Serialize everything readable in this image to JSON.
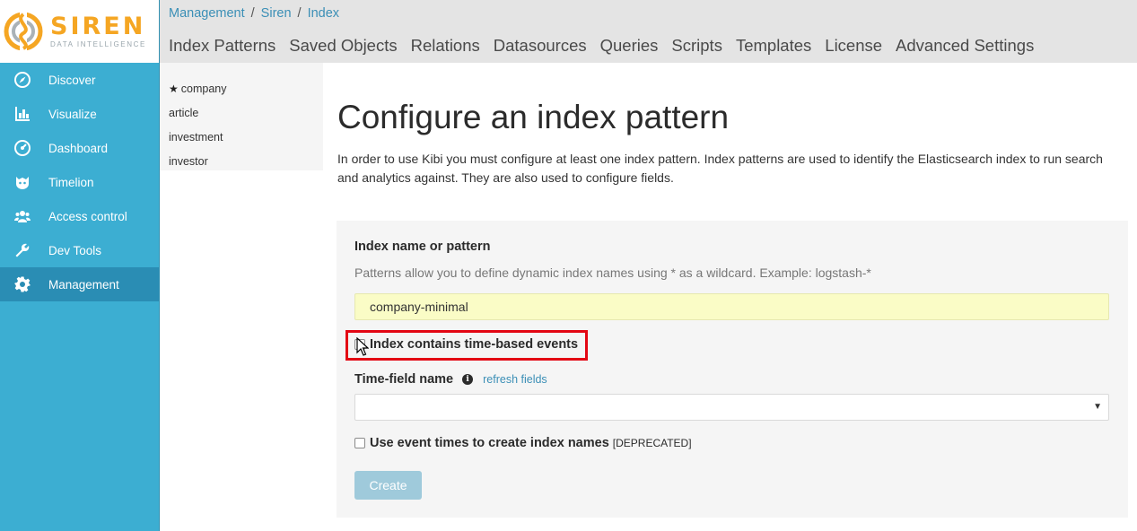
{
  "logo": {
    "word": "SIREN",
    "sub": "DATA INTELLIGENCE"
  },
  "sidebar": {
    "items": [
      {
        "label": "Discover",
        "icon": "compass-icon"
      },
      {
        "label": "Visualize",
        "icon": "bar-chart-icon"
      },
      {
        "label": "Dashboard",
        "icon": "dashboard-icon"
      },
      {
        "label": "Timelion",
        "icon": "timelion-icon"
      },
      {
        "label": "Access control",
        "icon": "users-icon"
      },
      {
        "label": "Dev Tools",
        "icon": "wrench-icon"
      },
      {
        "label": "Management",
        "icon": "gear-icon",
        "active": true
      }
    ]
  },
  "breadcrumb": [
    "Management",
    "Siren",
    "Index"
  ],
  "tabs": [
    "Index Patterns",
    "Saved Objects",
    "Relations",
    "Datasources",
    "Queries",
    "Scripts",
    "Templates",
    "License",
    "Advanced Settings"
  ],
  "index_list": [
    {
      "label": "company",
      "default": true
    },
    {
      "label": "article"
    },
    {
      "label": "investment"
    },
    {
      "label": "investor"
    }
  ],
  "main": {
    "title": "Configure an index pattern",
    "intro": "In order to use Kibi you must configure at least one index pattern. Index patterns are used to identify the Elasticsearch index to run search and analytics against. They are also used to configure fields."
  },
  "form": {
    "name_label": "Index name or pattern",
    "help": "Patterns allow you to define dynamic index names using * as a wildcard. Example: logstash-*",
    "name_value": "company-minimal",
    "time_based_label": "Index contains time-based events",
    "time_based_checked": false,
    "time_field_label": "Time-field name",
    "refresh_label": "refresh fields",
    "time_field_value": "",
    "event_times_label": "Use event times to create index names",
    "deprecated_label": "[DEPRECATED]",
    "event_times_checked": false,
    "create_label": "Create"
  },
  "colors": {
    "sidebar": "#3caed2",
    "sidebar_active": "#2a8db4",
    "accent_link": "#3b8fb6",
    "highlight_border": "#e30613",
    "input_bg": "#fafcc6",
    "button_disabled": "#9fcadb",
    "logo": "#f5a623"
  }
}
